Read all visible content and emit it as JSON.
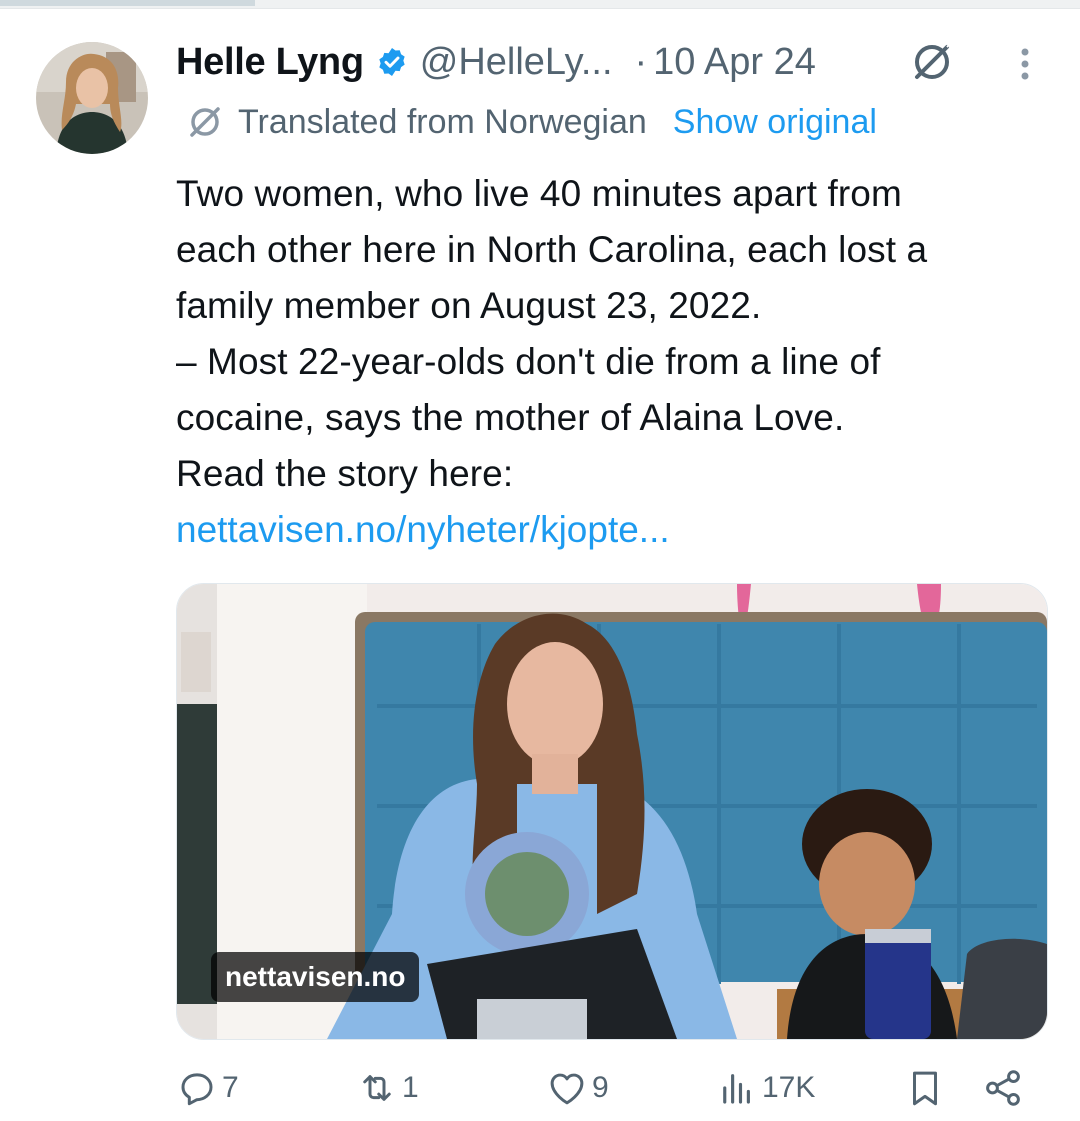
{
  "author": {
    "name": "Helle Lyng",
    "handle": "@HelleLy...",
    "separator": "·",
    "date": "10 Apr 24"
  },
  "translation": {
    "notice": "Translated from Norwegian",
    "show_original": "Show original"
  },
  "tweet": {
    "text": "Two women, who live 40 minutes apart from\neach other here in North Carolina, each lost a\nfamily member on August 23, 2022.\n– Most 22-year-olds don't die from a line of\ncocaine, says the mother of Alaina Love.\nRead the story here:",
    "link": "nettavisen.no/nyheter/kjopte..."
  },
  "media": {
    "badge": "nettavisen.no"
  },
  "actions": {
    "replies": "7",
    "reposts": "1",
    "likes": "9",
    "views": "17K"
  },
  "colors": {
    "accent": "#1d9bf0",
    "secondary_text": "#536471",
    "verified": "#1d9bf0"
  },
  "icons": [
    "verified-badge-icon",
    "grok-icon",
    "more-icon",
    "translate-icon",
    "reply-icon",
    "repost-icon",
    "like-icon",
    "views-icon",
    "bookmark-icon",
    "share-icon"
  ]
}
